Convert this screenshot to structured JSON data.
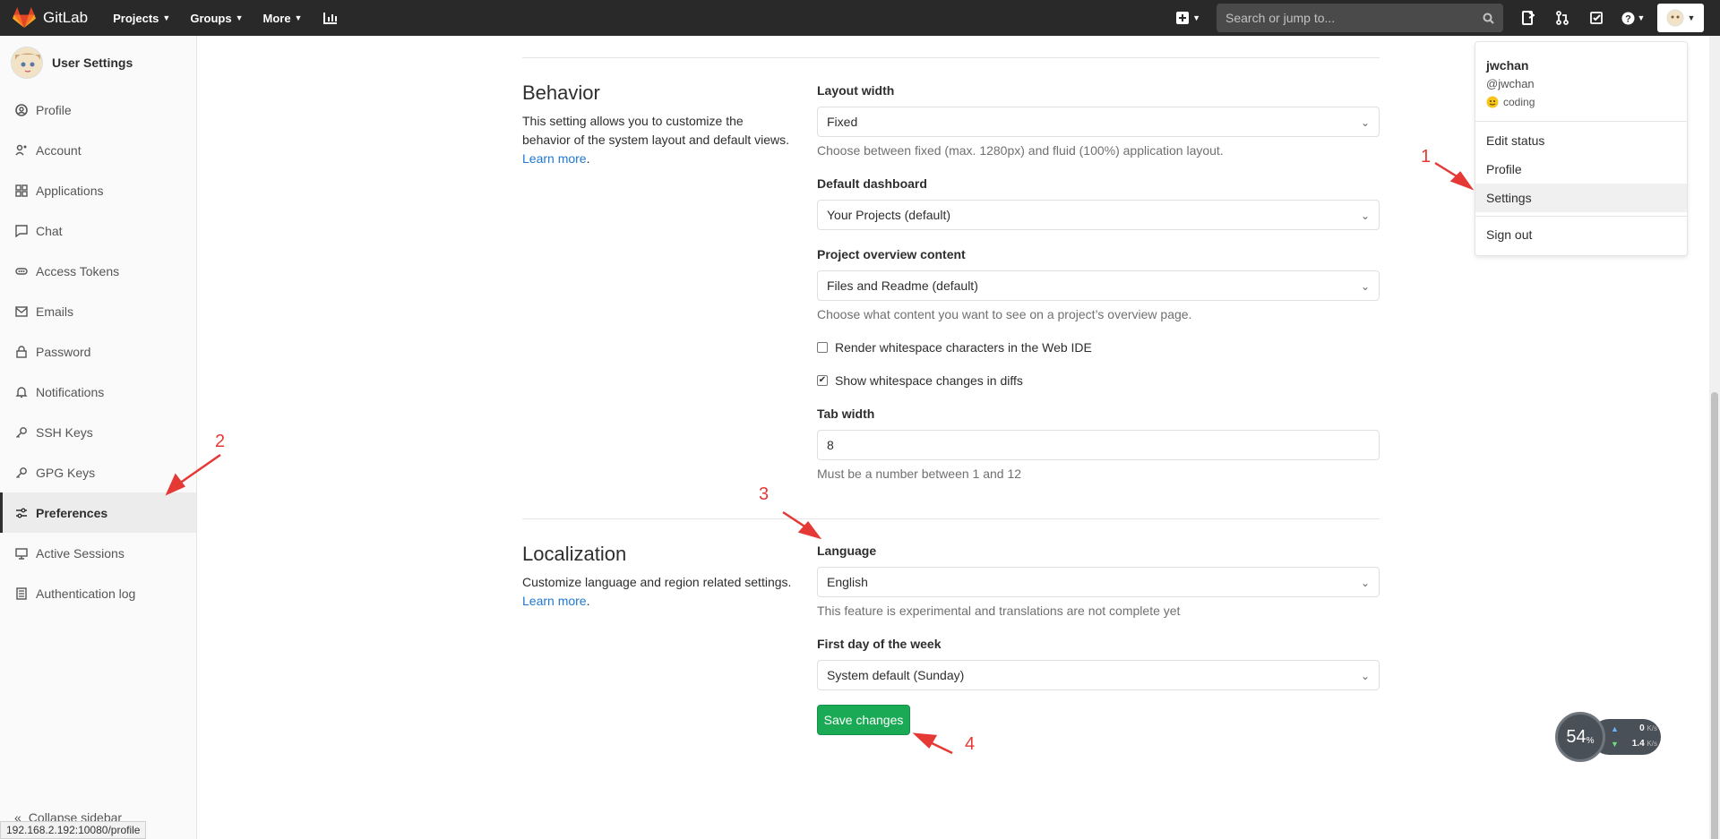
{
  "navbar": {
    "brand": "GitLab",
    "links": [
      "Projects",
      "Groups",
      "More"
    ],
    "search_placeholder": "Search or jump to..."
  },
  "sidebar": {
    "title": "User Settings",
    "items": [
      {
        "label": "Profile",
        "icon": "user-circle-icon"
      },
      {
        "label": "Account",
        "icon": "account-icon"
      },
      {
        "label": "Applications",
        "icon": "grid-icon"
      },
      {
        "label": "Chat",
        "icon": "chat-icon"
      },
      {
        "label": "Access Tokens",
        "icon": "token-icon"
      },
      {
        "label": "Emails",
        "icon": "mail-icon"
      },
      {
        "label": "Password",
        "icon": "lock-icon"
      },
      {
        "label": "Notifications",
        "icon": "bell-icon"
      },
      {
        "label": "SSH Keys",
        "icon": "key-icon"
      },
      {
        "label": "GPG Keys",
        "icon": "key-icon"
      },
      {
        "label": "Preferences",
        "icon": "sliders-icon"
      },
      {
        "label": "Active Sessions",
        "icon": "monitor-icon"
      },
      {
        "label": "Authentication log",
        "icon": "list-icon"
      }
    ],
    "active": "Preferences",
    "collapse": "Collapse sidebar",
    "status_url": "192.168.2.192:10080/profile"
  },
  "behavior": {
    "title": "Behavior",
    "desc": "This setting allows you to customize the behavior of the system layout and default views.",
    "learn_more": "Learn more",
    "layout_width_label": "Layout width",
    "layout_width_value": "Fixed",
    "layout_width_help": "Choose between fixed (max. 1280px) and fluid (100%) application layout.",
    "dashboard_label": "Default dashboard",
    "dashboard_value": "Your Projects (default)",
    "overview_label": "Project overview content",
    "overview_value": "Files and Readme (default)",
    "overview_help": "Choose what content you want to see on a project’s overview page.",
    "render_ws_label": "Render whitespace characters in the Web IDE",
    "render_ws_checked": false,
    "show_ws_label": "Show whitespace changes in diffs",
    "show_ws_checked": true,
    "tab_width_label": "Tab width",
    "tab_width_value": "8",
    "tab_width_help": "Must be a number between 1 and 12"
  },
  "localization": {
    "title": "Localization",
    "desc": "Customize language and region related settings.",
    "learn_more": "Learn more",
    "language_label": "Language",
    "language_value": "English",
    "language_help": "This feature is experimental and translations are not complete yet",
    "first_day_label": "First day of the week",
    "first_day_value": "System default (Sunday)",
    "save": "Save changes"
  },
  "user_menu": {
    "name": "jwchan",
    "handle": "@jwchan",
    "status": "coding",
    "items": [
      "Edit status",
      "Profile",
      "Settings",
      "Sign out"
    ],
    "hovered": "Settings"
  },
  "annotations": [
    "1",
    "2",
    "3",
    "4"
  ],
  "annotation_color": "#e53935",
  "speed_widget": {
    "percent": "54",
    "percent_sign": "%",
    "up": "0",
    "up_unit": "K/s",
    "down": "1.4",
    "down_unit": "K/s"
  },
  "colors": {
    "navbar": "#292929",
    "save_button": "#1aaa55",
    "link": "#1f78d1"
  }
}
